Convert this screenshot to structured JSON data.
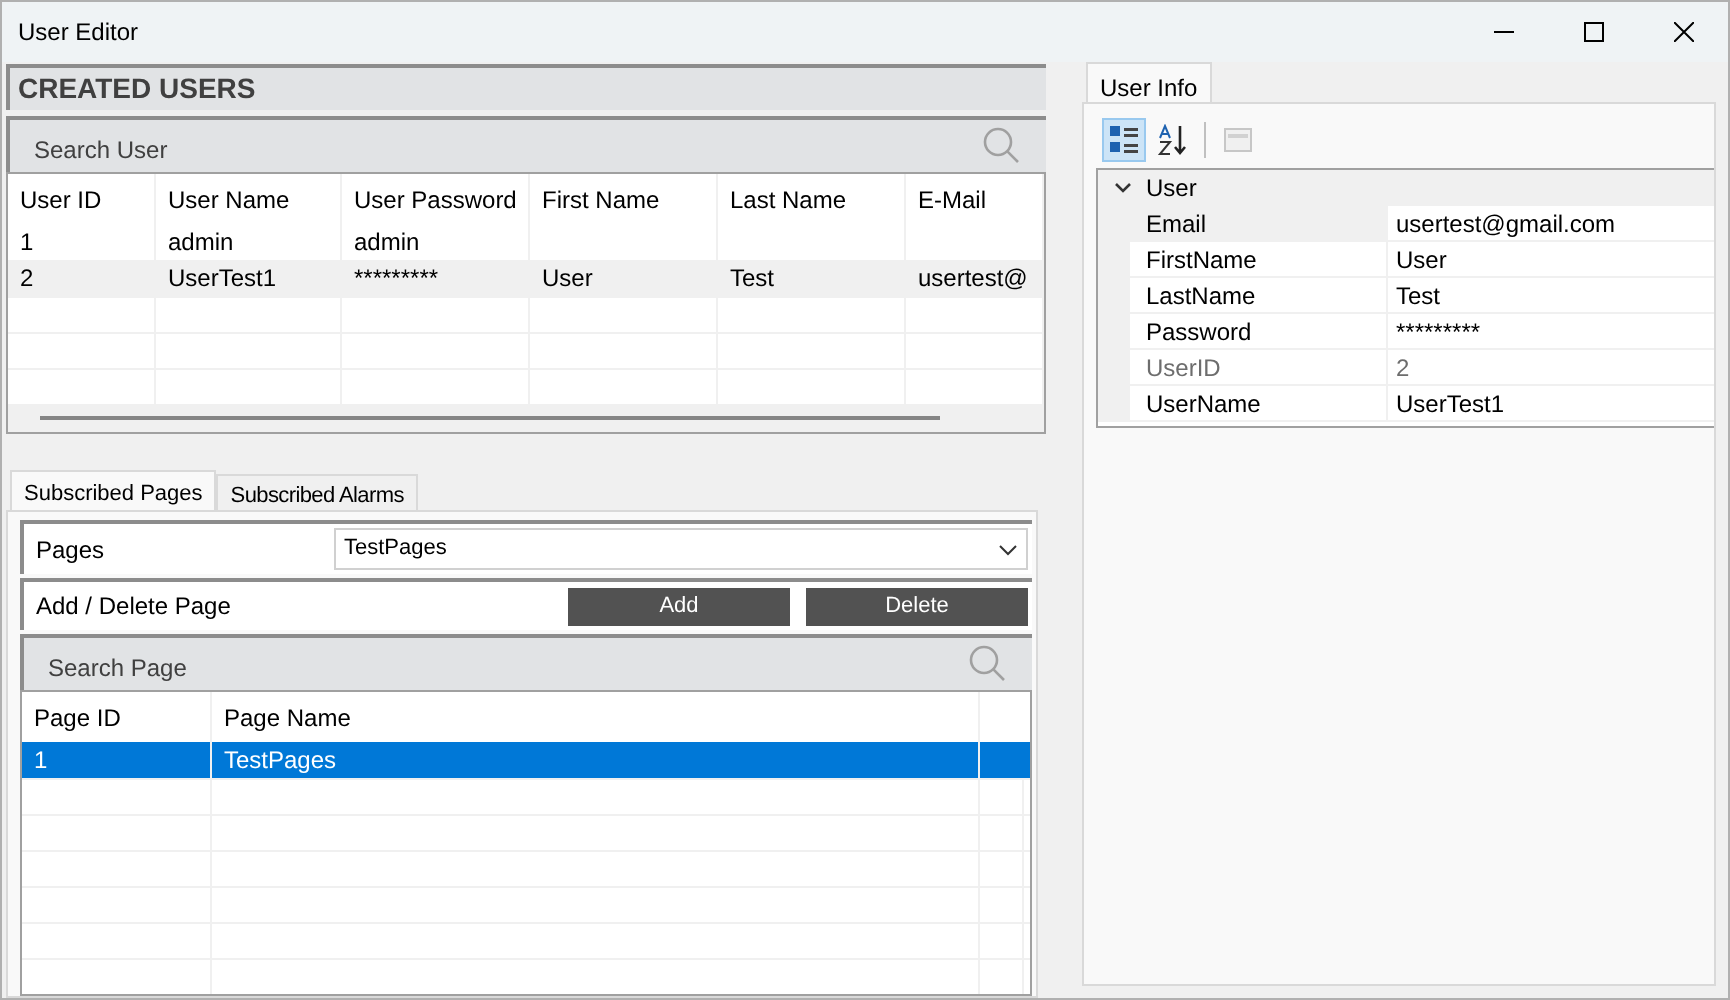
{
  "window": {
    "title": "User Editor"
  },
  "users": {
    "title": "CREATED USERS",
    "search": {
      "placeholder": "Search User"
    },
    "columns": [
      "User ID",
      "User Name",
      "User Password",
      "First Name",
      "Last Name",
      "E-Mail"
    ],
    "rows": [
      {
        "cells": [
          "1",
          "admin",
          "admin",
          "",
          "",
          ""
        ],
        "selected": false
      },
      {
        "cells": [
          "2",
          "UserTest1",
          "*********",
          "User",
          "Test",
          "usertest@"
        ],
        "selected": true
      }
    ]
  },
  "tabs": [
    {
      "label": "Subscribed Pages",
      "selected": true
    },
    {
      "label": "Subscribed Alarms",
      "selected": false
    }
  ],
  "pages": {
    "label": "Pages",
    "value": "TestPages",
    "action_label": "Add / Delete Page",
    "buttons": [
      "Add",
      "Delete"
    ],
    "search": {
      "placeholder": "Search Page"
    },
    "columns": [
      "Page ID",
      "Page Name"
    ],
    "rows": [
      {
        "cells": [
          "1",
          "TestPages"
        ],
        "selected": true
      }
    ]
  },
  "info": {
    "tab": "User Info",
    "toolbar": [
      {
        "kind": "categorized",
        "selected": true,
        "disabled": false
      },
      {
        "kind": "alphabetical",
        "selected": false,
        "disabled": false
      },
      {
        "kind": "pages",
        "selected": false,
        "disabled": true
      }
    ],
    "category": {
      "name": "User",
      "expanded": true
    },
    "properties": [
      {
        "name": "Email",
        "value": "usertest@gmail.com",
        "selected": true,
        "readonly": false
      },
      {
        "name": "FirstName",
        "value": "User",
        "selected": false,
        "readonly": false
      },
      {
        "name": "LastName",
        "value": "Test",
        "selected": false,
        "readonly": false
      },
      {
        "name": "Password",
        "value": "*********",
        "selected": false,
        "readonly": false
      },
      {
        "name": "UserID",
        "value": "2",
        "selected": false,
        "readonly": true
      },
      {
        "name": "UserName",
        "value": "UserTest1",
        "selected": false,
        "readonly": false
      }
    ]
  }
}
